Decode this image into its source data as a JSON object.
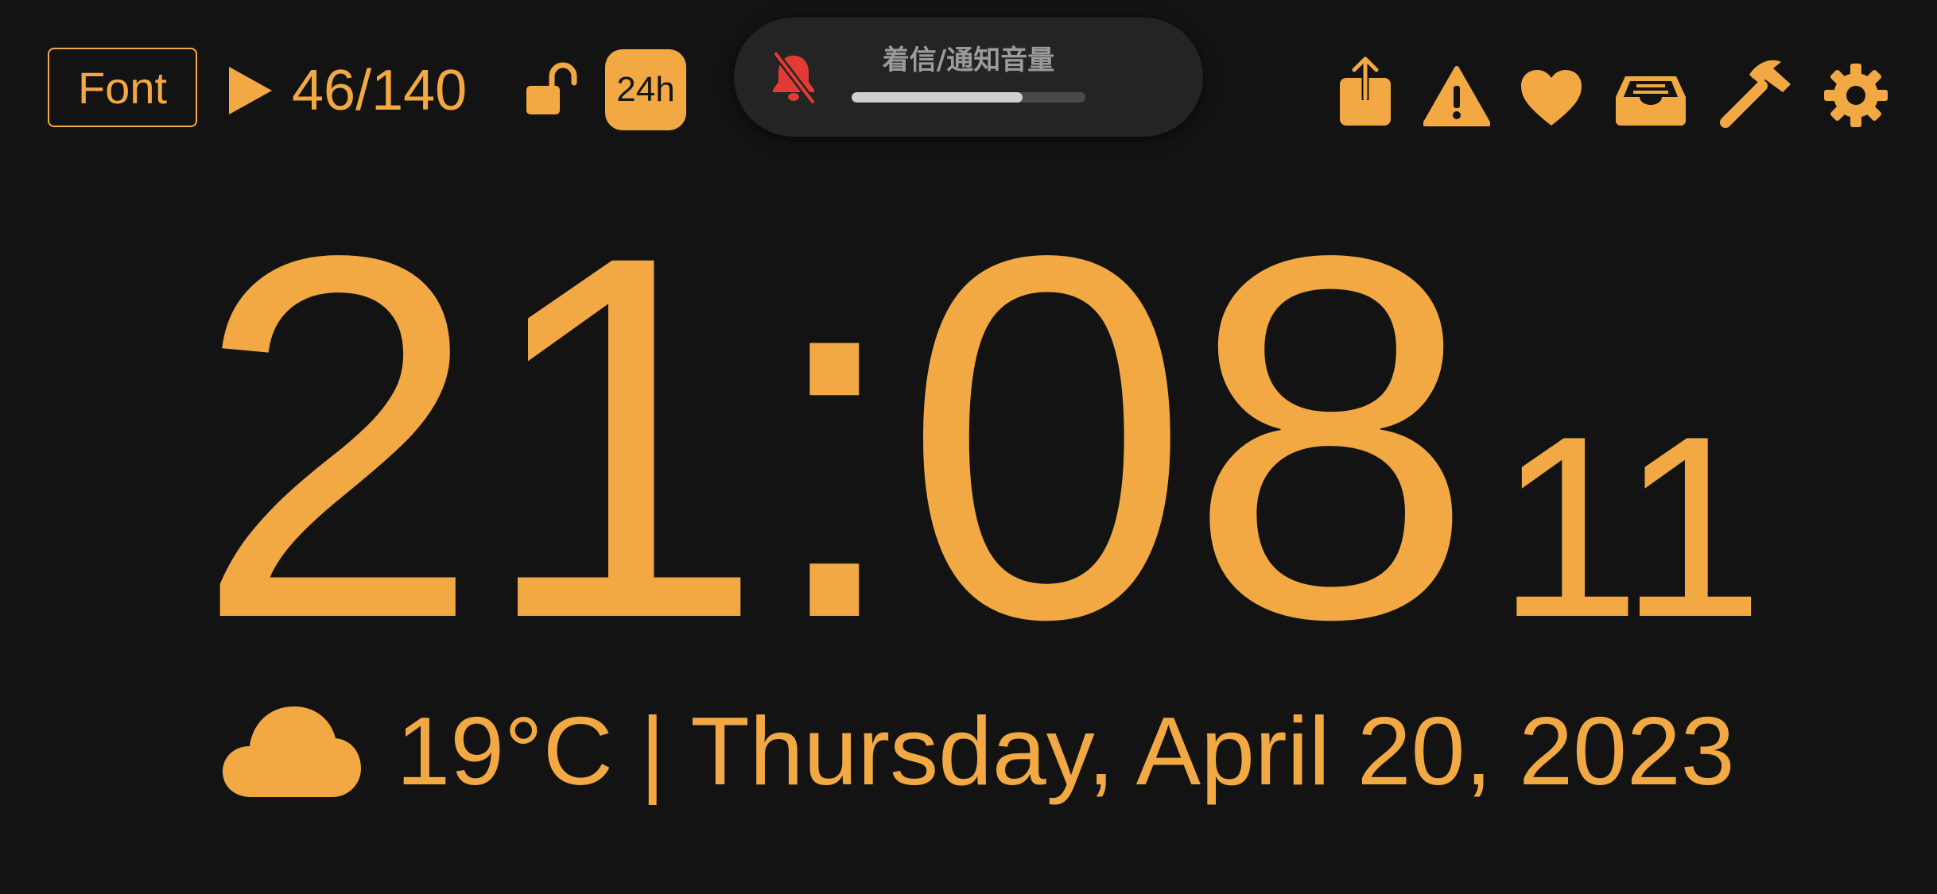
{
  "colors": {
    "background": "#131313",
    "accent": "#F2A944",
    "hud_background": "#242424",
    "hud_text": "#9b9b9b",
    "mute_icon": "#E23B35"
  },
  "toolbar": {
    "font_label": "Font",
    "play_icon": "play-icon",
    "counter": "46/140",
    "lock_icon": "lock-open-icon",
    "hour_mode_label": "24h",
    "right_icons": [
      "share-icon",
      "warning-icon",
      "heart-icon",
      "inbox-icon",
      "hammer-icon",
      "gear-icon"
    ]
  },
  "volume_hud": {
    "icon": "bell-slash-icon",
    "label": "着信/通知音量",
    "level": 0.73
  },
  "clock": {
    "time": "21:08",
    "seconds": "11"
  },
  "info": {
    "weather_icon": "cloud-icon",
    "text": "19°C | Thursday, April 20, 2023"
  }
}
